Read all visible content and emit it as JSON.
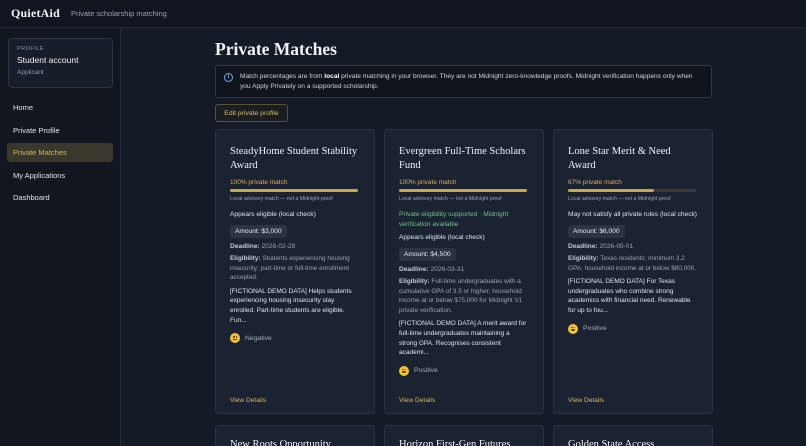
{
  "app": {
    "brand": "QuietAid",
    "tagline": "Private scholarship matching"
  },
  "sidebar": {
    "profile_kicker": "PROFILE",
    "profile_name": "Student account",
    "profile_role": "Applicant",
    "items": [
      {
        "label": "Home"
      },
      {
        "label": "Private Profile"
      },
      {
        "label": "Private Matches",
        "active": true
      },
      {
        "label": "My Applications"
      },
      {
        "label": "Dashboard"
      }
    ]
  },
  "page": {
    "title": "Private Matches",
    "notice_pre": "Match percentages are from ",
    "notice_bold": "local",
    "notice_post": " private matching in your browser. They are not Midnight zero-knowledge proofs. Midnight verification happens only when you Apply Privately on a supported scholarship.",
    "edit_button": "Edit private profile"
  },
  "cards": [
    {
      "title": "SteadyHome Student Stability Award",
      "match": "100% private match",
      "match_fraction": 1.0,
      "advisory": "Local advisory match — not a Midnight proof",
      "supported": "",
      "status": "Appears eligible (local check)",
      "amount": "Amount: $3,000",
      "deadline_label": "Deadline:",
      "deadline": " 2026-02-28",
      "eligibility_label": "Eligibility:",
      "eligibility": " Students experiencing housing insecurity; part-time or full-time enrollment accepted.",
      "description": "[FICTIONAL DEMO DATA] Helps students experiencing housing insecurity stay enrolled. Part-time students are eligible. Fun...",
      "sentiment": "Negative",
      "view": "View Details"
    },
    {
      "title": "Evergreen Full-Time Scholars Fund",
      "match": "100% private match",
      "match_fraction": 1.0,
      "advisory": "Local advisory match — not a Midnight proof",
      "supported": "Private eligibility supported · Midnight verification available",
      "status": "Appears eligible (local check)",
      "amount": "Amount: $4,500",
      "deadline_label": "Deadline:",
      "deadline": " 2026-03-31",
      "eligibility_label": "Eligibility:",
      "eligibility": " Full-time undergraduates with a cumulative GPA of 3.5 or higher; household income at or below $75,000 for Midnight V1 private verification.",
      "description": "[FICTIONAL DEMO DATA] A merit award for full-time undergraduates maintaining a strong GPA. Recognises consistent academi...",
      "sentiment": "Positive",
      "view": "View Details"
    },
    {
      "title": "Lone Star Merit & Need Award",
      "match": "67% private match",
      "match_fraction": 0.67,
      "advisory": "Local advisory match — not a Midnight proof",
      "supported": "",
      "status": "May not satisfy all private rules (local check)",
      "amount": "Amount: $6,000",
      "deadline_label": "Deadline:",
      "deadline": " 2026-05-01",
      "eligibility_label": "Eligibility:",
      "eligibility": " Texas residents; minimum 3.2 GPA; household income at or below $80,000.",
      "description": "[FICTIONAL DEMO DATA] For Texas undergraduates who combine strong academics with financial need. Renewable for up to fou...",
      "sentiment": "Positive",
      "view": "View Details"
    }
  ],
  "partial_cards": [
    {
      "title": "New Roots Opportunity"
    },
    {
      "title": "Horizon First-Gen Futures"
    },
    {
      "title": "Golden State Access"
    }
  ],
  "colors": {
    "accent": "#d4b35a",
    "success": "#6ec286",
    "background": "#141a26"
  }
}
